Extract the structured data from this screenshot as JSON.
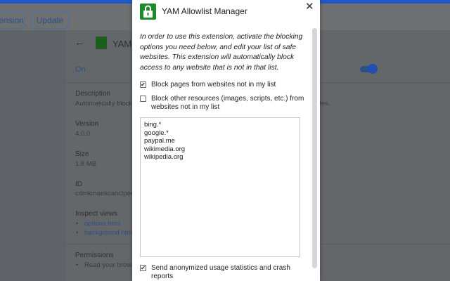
{
  "background": {
    "toolbar": {
      "extension_button": "ension",
      "update_button": "Update"
    },
    "extension_title": "YAM A",
    "toggle_label": "On",
    "description_label": "Description",
    "description_text": "Automatically block",
    "description_tail": "ites.",
    "version_label": "Version",
    "version_value": "4.0.0",
    "size_label": "Size",
    "size_value": "1.8 MB",
    "id_label": "ID",
    "id_value": "cdmkmaekcanclpee",
    "inspect_label": "Inspect views",
    "inspect_links": [
      "options.html",
      "background.html"
    ],
    "permissions_label": "Permissions",
    "permissions_item": "Read your brows"
  },
  "dialog": {
    "title": "YAM Allowlist Manager",
    "close_glyph": "✕",
    "intro": "In order to use this extension, activate the blocking options you need below, and edit your list of safe websites. This extension will automatically block access to any website that is not in that list.",
    "options": [
      {
        "label": "Block pages from websites not in my list",
        "checked": true
      },
      {
        "label": "Block other resources (images, scripts, etc.) from websites not in my list",
        "checked": false
      }
    ],
    "allowlist": [
      "bing.*",
      "google.*",
      "paypal.me",
      "wikimedia.org",
      "wikipedia.org"
    ],
    "stats_option": {
      "label": "Send anonymized usage statistics and crash reports",
      "checked": true
    }
  },
  "colors": {
    "accent_green": "#1e8a2a",
    "link_blue": "#2e4f88",
    "top_bar": "#1f58c8"
  }
}
